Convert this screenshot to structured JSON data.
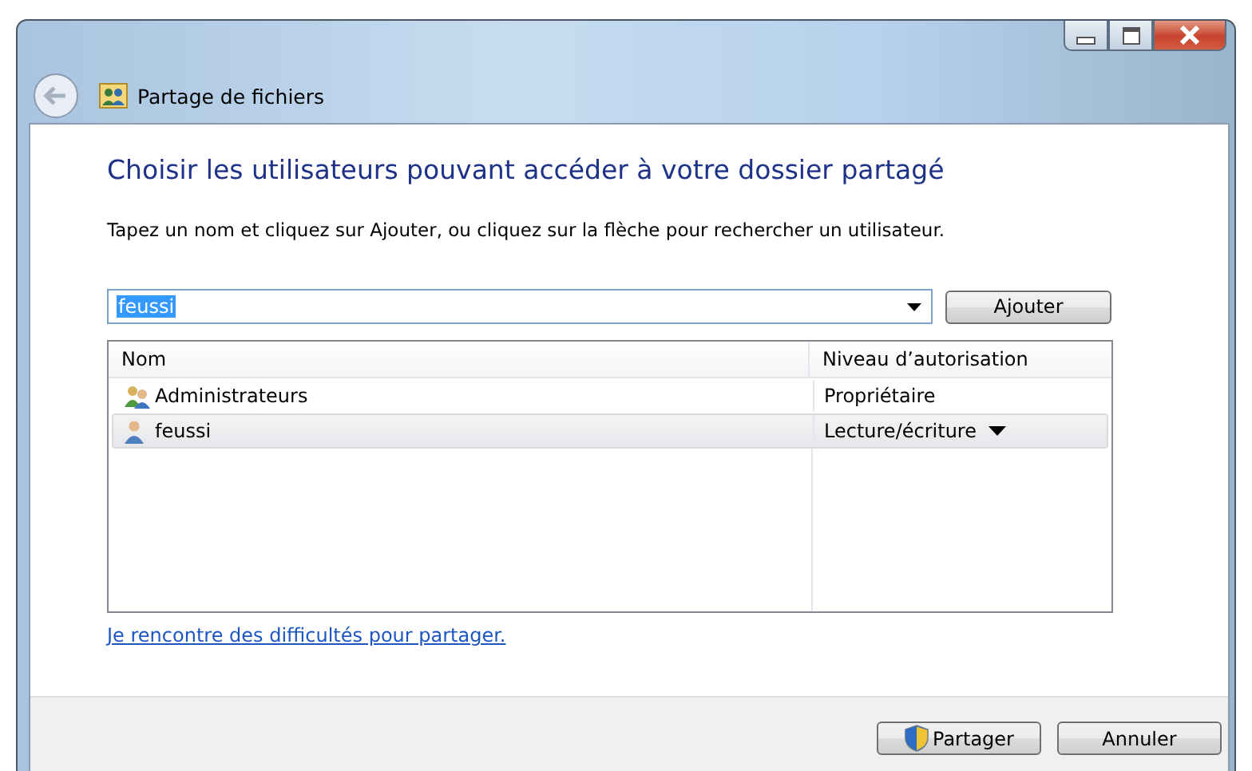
{
  "window": {
    "title": "Partage de fichiers"
  },
  "heading": "Choisir les utilisateurs pouvant accéder à votre dossier partagé",
  "instruction": "Tapez un nom et cliquez sur Ajouter, ou cliquez sur la flèche pour rechercher un utilisateur.",
  "name_field": {
    "value": "feussi"
  },
  "add_button": "Ajouter",
  "table": {
    "columns": [
      "Nom",
      "Niveau d’autorisation"
    ],
    "rows": [
      {
        "kind": "group",
        "name": "Administrateurs",
        "level": "Propriétaire",
        "dropdown": false,
        "selected": false
      },
      {
        "kind": "user",
        "name": "feussi",
        "level": "Lecture/écriture",
        "dropdown": true,
        "selected": true
      }
    ]
  },
  "help_link": "Je rencontre des difficultés pour partager.",
  "buttons": [
    {
      "kind": "shield",
      "label": "Partager"
    },
    {
      "kind": "plain",
      "label": "Annuler"
    }
  ]
}
